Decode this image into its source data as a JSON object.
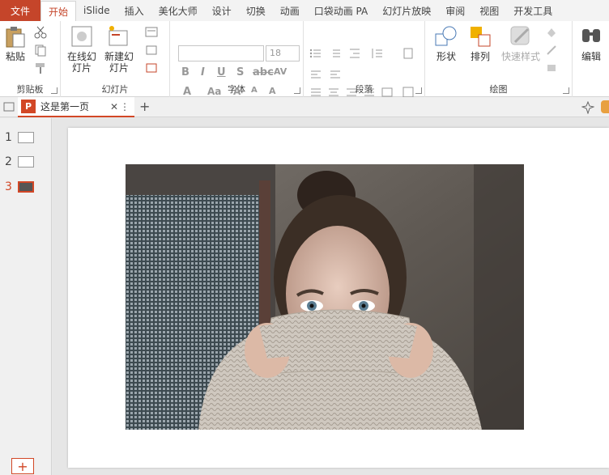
{
  "menubar": {
    "file": "文件",
    "tabs": [
      "开始",
      "iSlide",
      "插入",
      "美化大师",
      "设计",
      "切换",
      "动画",
      "口袋动画 PA",
      "幻灯片放映",
      "审阅",
      "视图",
      "开发工具"
    ]
  },
  "ribbon": {
    "clipboard": {
      "paste": "粘贴",
      "label": "剪贴板"
    },
    "slides": {
      "online": "在线幻灯片",
      "new_slide": "新建幻灯片",
      "label": "幻灯片"
    },
    "font": {
      "size": "18",
      "label": "字体"
    },
    "paragraph": {
      "label": "段落"
    },
    "drawing": {
      "shape": "形状",
      "arrange": "排列",
      "quick_style": "快速样式",
      "label": "绘图"
    },
    "editing": {
      "edit": "编辑"
    }
  },
  "docbar": {
    "tab_title": "这是第一页",
    "close": "✕",
    "add": "+"
  },
  "thumbnails": [
    {
      "num": "1"
    },
    {
      "num": "2"
    },
    {
      "num": "3"
    }
  ],
  "colors": {
    "accent": "#d24726",
    "file_tab": "#c5452a"
  },
  "icons": [
    "paste-icon",
    "cut-icon",
    "copy-icon",
    "format-painter-icon",
    "online-slide-icon",
    "new-slide-icon",
    "shape-icon",
    "arrange-icon",
    "quick-style-icon",
    "find-icon"
  ]
}
